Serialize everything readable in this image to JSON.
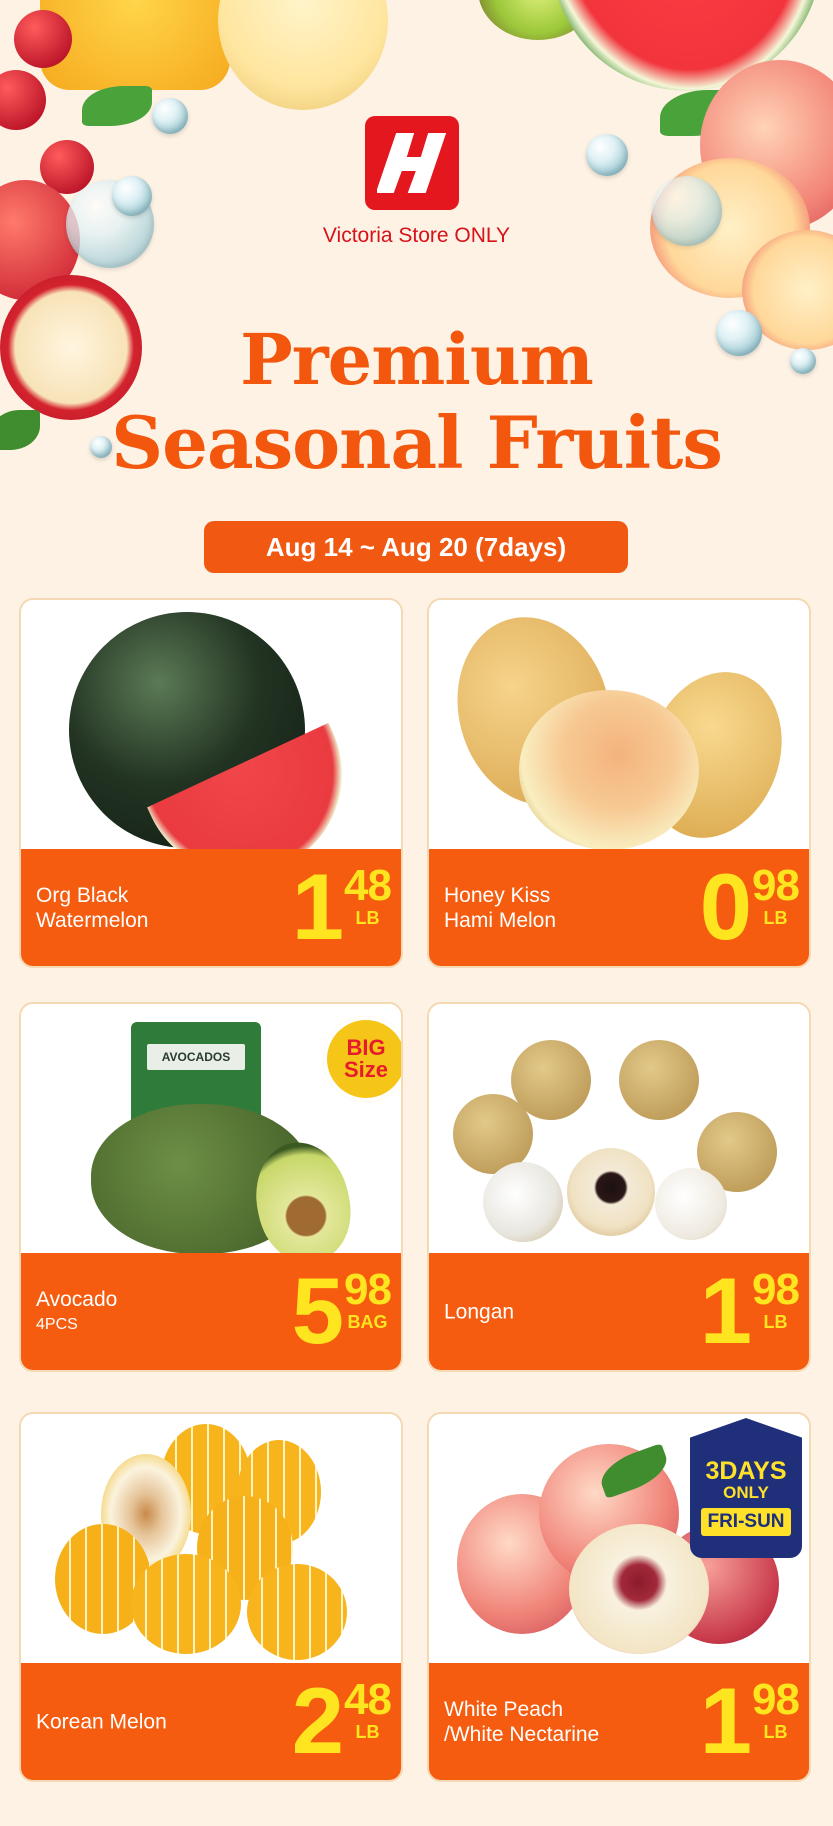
{
  "store_line": "Victoria Store ONLY",
  "headline": {
    "line1": "Premium",
    "line2": "Seasonal Fruits"
  },
  "date_range": "Aug 14 ~ Aug 20 (7days)",
  "products": [
    {
      "name_line1": "Org Black",
      "name_line2": "Watermelon",
      "price_whole": "1",
      "price_cents": "48",
      "unit": "LB"
    },
    {
      "name_line1": "Honey Kiss",
      "name_line2": "Hami Melon",
      "price_whole": "0",
      "price_cents": "98",
      "unit": "LB"
    },
    {
      "name_line1": "Avocado",
      "name_sub": "4PCS",
      "price_whole": "5",
      "price_cents": "98",
      "unit": "BAG",
      "badge_line1": "BIG",
      "badge_line2": "Size",
      "bag_label": "AVOCADOS"
    },
    {
      "name_line1": "Longan",
      "price_whole": "1",
      "price_cents": "98",
      "unit": "LB"
    },
    {
      "name_line1": "Korean Melon",
      "price_whole": "2",
      "price_cents": "48",
      "unit": "LB"
    },
    {
      "name_line1": "White Peach",
      "name_line2": "/White Nectarine",
      "price_whole": "1",
      "price_cents": "98",
      "unit": "LB",
      "badge_line1": "3DAYS",
      "badge_line2": "ONLY",
      "badge_line3": "FRI-SUN"
    }
  ],
  "colors": {
    "orange": "#f55c0f",
    "price_yellow": "#ffe51f",
    "logo_red": "#e4161e",
    "background": "#fdf2e4"
  }
}
